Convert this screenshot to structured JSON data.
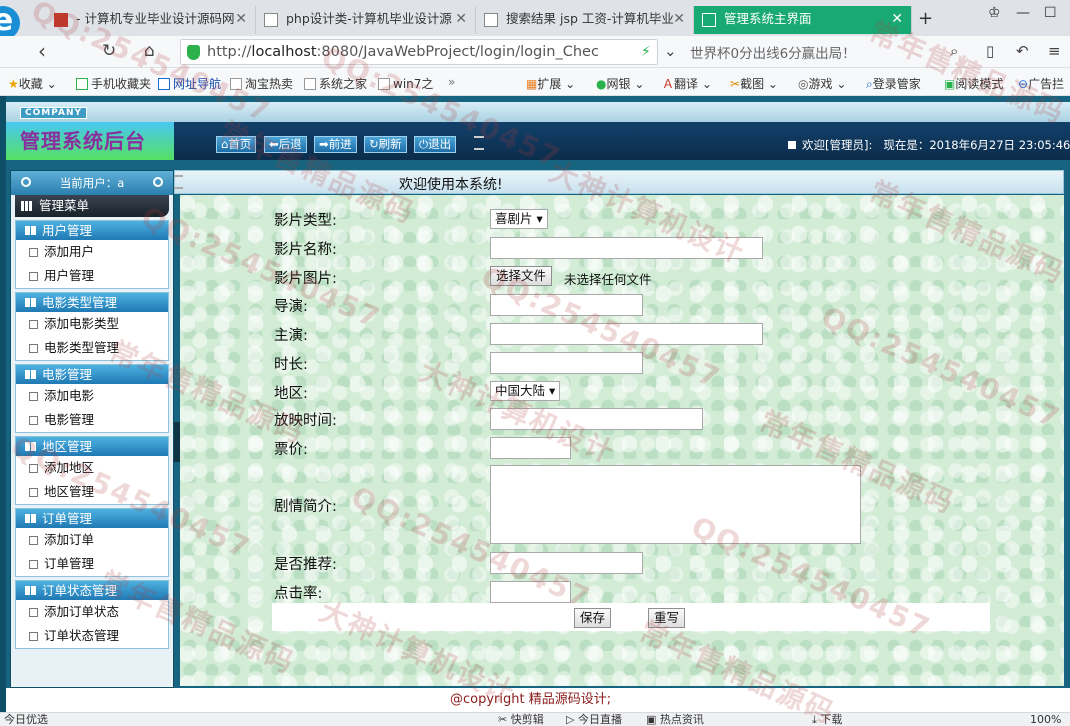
{
  "browser": {
    "tabs": [
      {
        "title": "- 计算机专业毕业设计源码网",
        "active": false
      },
      {
        "title": "php设计类-计算机毕业设计源",
        "active": false
      },
      {
        "title": "搜索结果 jsp 工资-计算机毕业",
        "active": false
      },
      {
        "title": "管理系统主界面",
        "active": true
      }
    ],
    "url_prefix": "http://",
    "url_host": "localhost",
    "url_rest": ":8080/JavaWebProject/login/login_Chec",
    "search_text": "世界杯0分出线6分赢出局！",
    "bookmarks": [
      "收藏",
      "手机收藏夹",
      "网址导航",
      "淘宝热卖",
      "系统之家",
      "win7之",
      "扩展",
      "网银",
      "翻译",
      "截图",
      "游戏",
      "登录管家",
      "阅读模式",
      "广告拦"
    ],
    "accent": "#19a974"
  },
  "app": {
    "company": "COMPANY",
    "brand": "管理系统后台",
    "toolbar": {
      "home": "首页",
      "back": "后退",
      "forward": "前进",
      "refresh": "刷新",
      "logout": "退出"
    },
    "welcome": "欢迎[管理员]:",
    "time_prefix": "现在是：",
    "time": "2018年6月27日 23:05:46",
    "main_title": "欢迎使用本系统!"
  },
  "sidebar": {
    "current_user": "当前用户：a",
    "menu_title": "管理菜单",
    "groups": [
      {
        "title": "用户管理",
        "items": [
          "添加用户",
          "用户管理"
        ]
      },
      {
        "title": "电影类型管理",
        "items": [
          "添加电影类型",
          "电影类型管理"
        ]
      },
      {
        "title": "电影管理",
        "items": [
          "添加电影",
          "电影管理"
        ]
      },
      {
        "title": "地区管理",
        "items": [
          "添加地区",
          "地区管理"
        ]
      },
      {
        "title": "订单管理",
        "items": [
          "添加订单",
          "订单管理"
        ]
      },
      {
        "title": "订单状态管理",
        "items": [
          "添加订单状态",
          "订单状态管理"
        ]
      }
    ]
  },
  "form": {
    "type_label": "影片类型:",
    "type_value": "喜剧片",
    "name_label": "影片名称:",
    "image_label": "影片图片:",
    "file_button": "选择文件",
    "file_status": "未选择任何文件",
    "director_label": "导演:",
    "actor_label": "主演:",
    "duration_label": "时长:",
    "region_label": "地区:",
    "region_value": "中国大陆",
    "showtime_label": "放映时间:",
    "price_label": "票价:",
    "intro_label": "剧情简介:",
    "recommend_label": "是否推荐:",
    "clicks_label": "点击率:",
    "save_label": "保存",
    "reset_label": "重写"
  },
  "footer": {
    "copyright": "@copyright 精品源码设计;"
  },
  "statusbar": {
    "items": [
      "今日优选",
      "快剪辑",
      "今日直播",
      "热点资讯",
      "下载",
      "100%"
    ]
  },
  "watermarks": [
    "QQ:254540457",
    "大神计算机设计",
    "常年售精品源码"
  ]
}
